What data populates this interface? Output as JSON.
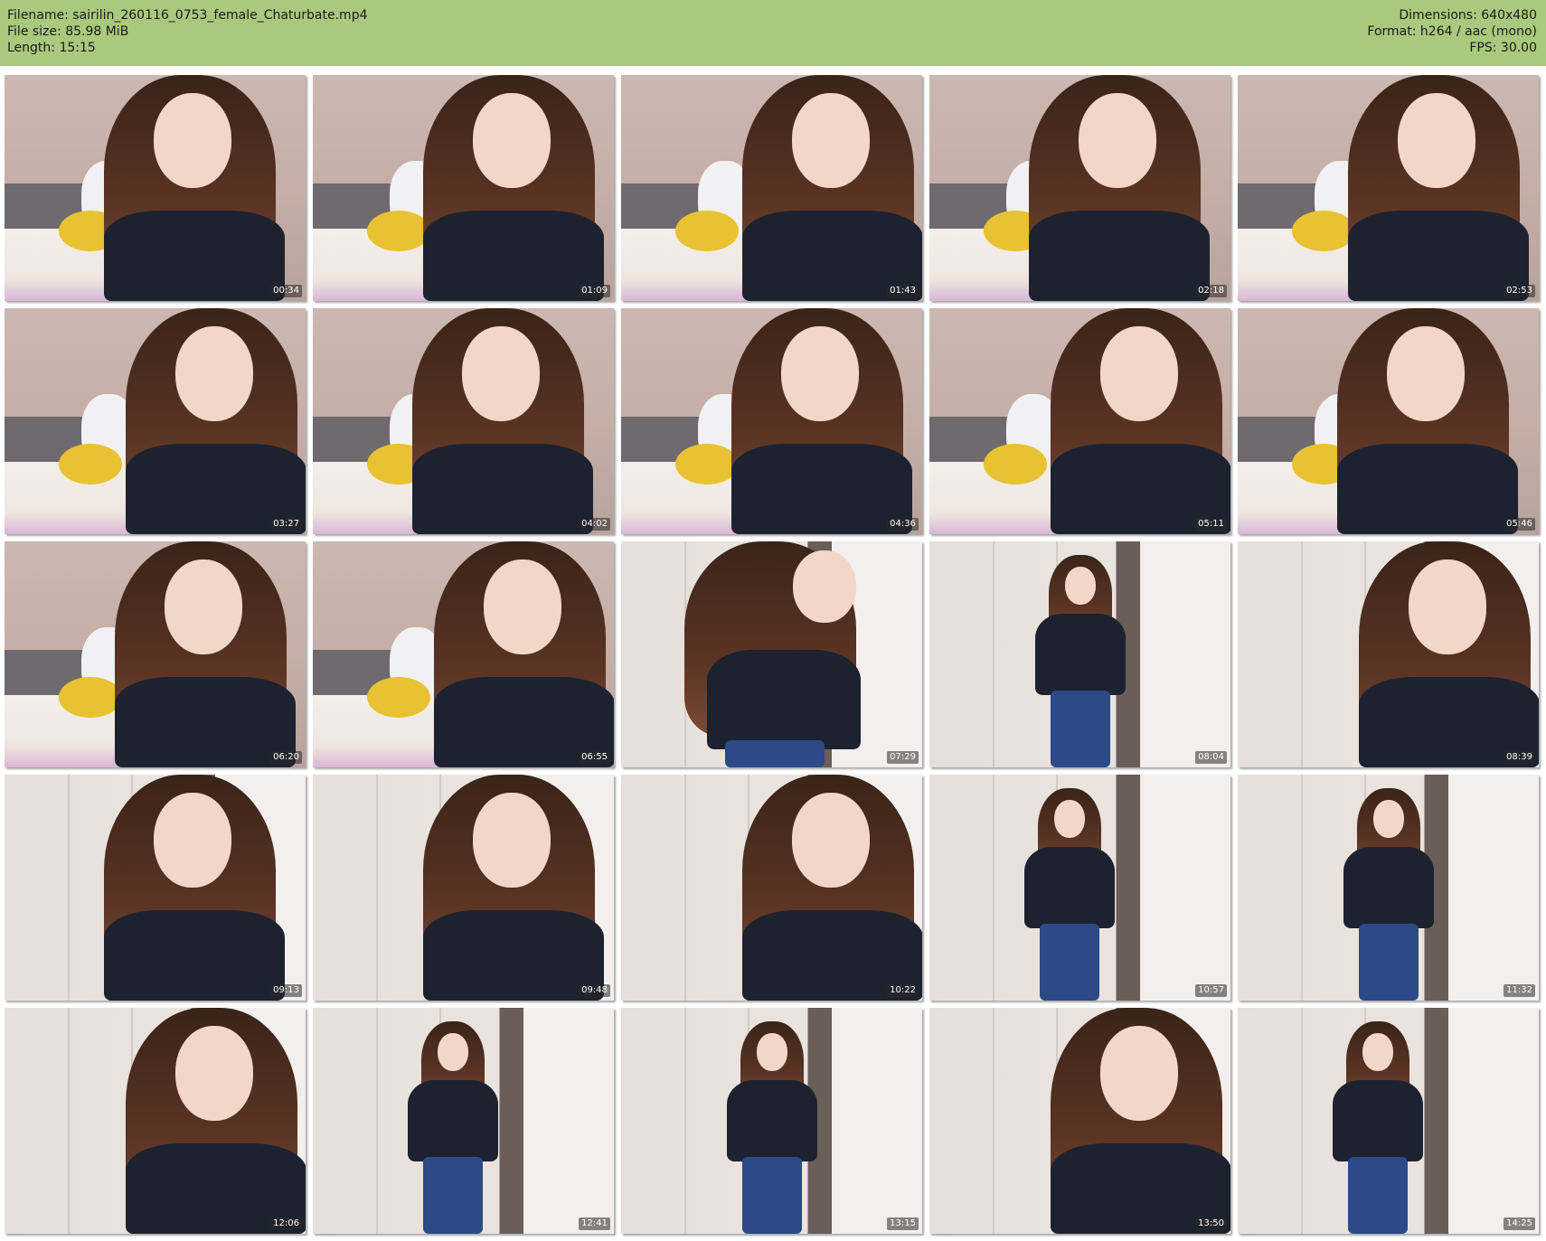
{
  "header": {
    "filename": "Filename: sairilin_260116_0753_female_Chaturbate.mp4",
    "filesize": "File size: 85.98 MiB",
    "length": "Length: 15:15",
    "dimensions": "Dimensions: 640x480",
    "format": "Format: h264 / aac (mono)",
    "fps": "FPS: 30.00"
  },
  "colors": {
    "header_bg": "#a9c97e"
  },
  "thumbnails": [
    {
      "time": "00:34",
      "scene": "bedroom",
      "pose": "close"
    },
    {
      "time": "01:09",
      "scene": "bedroom",
      "pose": "close"
    },
    {
      "time": "01:43",
      "scene": "bedroom",
      "pose": "close"
    },
    {
      "time": "02:18",
      "scene": "bedroom",
      "pose": "close"
    },
    {
      "time": "02:53",
      "scene": "bedroom",
      "pose": "close"
    },
    {
      "time": "03:27",
      "scene": "bedroom",
      "pose": "close"
    },
    {
      "time": "04:02",
      "scene": "bedroom",
      "pose": "close"
    },
    {
      "time": "04:36",
      "scene": "bedroom",
      "pose": "close"
    },
    {
      "time": "05:11",
      "scene": "bedroom",
      "pose": "close"
    },
    {
      "time": "05:46",
      "scene": "bedroom",
      "pose": "close"
    },
    {
      "time": "06:20",
      "scene": "bedroom",
      "pose": "close"
    },
    {
      "time": "06:55",
      "scene": "bedroom",
      "pose": "close"
    },
    {
      "time": "07:29",
      "scene": "wardrobe",
      "pose": "lean"
    },
    {
      "time": "08:04",
      "scene": "wardrobe",
      "pose": "full"
    },
    {
      "time": "08:39",
      "scene": "wardrobe",
      "pose": "close"
    },
    {
      "time": "09:13",
      "scene": "wardrobe",
      "pose": "close"
    },
    {
      "time": "09:48",
      "scene": "wardrobe",
      "pose": "close"
    },
    {
      "time": "10:22",
      "scene": "wardrobe",
      "pose": "close"
    },
    {
      "time": "10:57",
      "scene": "wardrobe",
      "pose": "full"
    },
    {
      "time": "11:32",
      "scene": "wardrobe",
      "pose": "full"
    },
    {
      "time": "12:06",
      "scene": "wardrobe",
      "pose": "close"
    },
    {
      "time": "12:41",
      "scene": "wardrobe",
      "pose": "full"
    },
    {
      "time": "13:15",
      "scene": "wardrobe",
      "pose": "full"
    },
    {
      "time": "13:50",
      "scene": "wardrobe",
      "pose": "close"
    },
    {
      "time": "14:25",
      "scene": "wardrobe",
      "pose": "full"
    }
  ]
}
